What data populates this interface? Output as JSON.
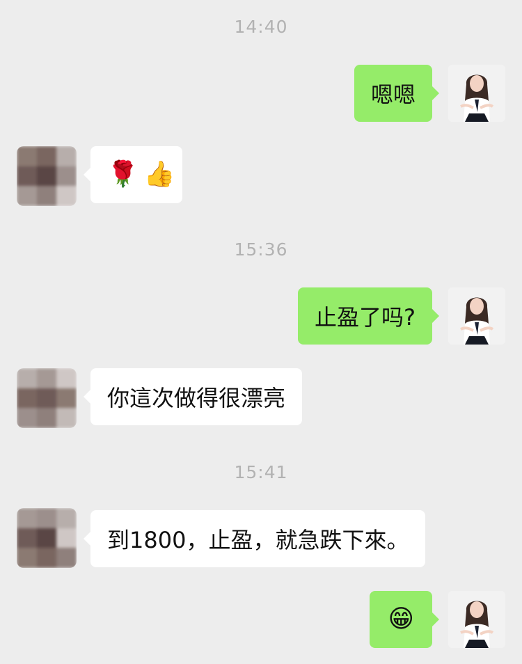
{
  "timestamps": [
    "14:40",
    "15:36",
    "15:41"
  ],
  "messages": [
    {
      "from": "self",
      "text": "嗯嗯"
    },
    {
      "from": "other",
      "emojis": [
        "🌹",
        "👍"
      ]
    },
    {
      "from": "self",
      "text": "止盈了吗?"
    },
    {
      "from": "other",
      "text": "你這次做得很漂亮"
    },
    {
      "from": "other",
      "text": "到1800，止盈，就急跌下來。"
    },
    {
      "from": "self",
      "emoji": "😁"
    }
  ],
  "avatars": {
    "self": {
      "icon": "woman-in-suit-avatar",
      "colors": {
        "bg": "#f2f2f2",
        "hair": "#3b2a24",
        "shirt": "#ffffff",
        "tie": "#1b2233",
        "skirt": "#161a24"
      }
    },
    "other": {
      "icon": "pixelated-avatar",
      "mosaic_colors": [
        "#8b7a72",
        "#7a6660",
        "#b7aeab",
        "#6f5b58",
        "#5a4645",
        "#9c8f8c",
        "#a59995",
        "#8f807c",
        "#cfc7c5"
      ]
    }
  },
  "colors": {
    "background": "#ededed",
    "self_bubble": "#95ec69",
    "other_bubble": "#ffffff",
    "timestamp": "#b2b2b2"
  }
}
